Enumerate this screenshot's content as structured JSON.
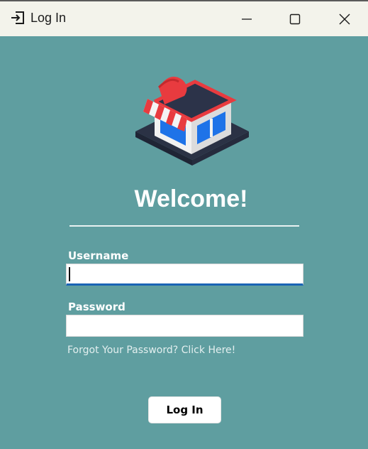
{
  "window": {
    "title": "Log In",
    "icons": {
      "app": "sign-in-icon",
      "minimize": "minimize-icon",
      "maximize": "maximize-icon",
      "close": "close-icon"
    }
  },
  "logo": {
    "icon": "storefront-icon",
    "colors": {
      "awning": "#e83b3f",
      "roof": "#2c3349",
      "window": "#1e73e8",
      "base": "#2b3245",
      "wall": "#f2f2f2"
    }
  },
  "heading": {
    "text": "Welcome!"
  },
  "form": {
    "username_label": "Username",
    "username_value": "",
    "password_label": "Password",
    "password_value": "",
    "forgot_link": "Forgot Your Password? Click Here!",
    "login_button": "Log In"
  },
  "colors": {
    "background": "#5f9ea0",
    "focus_underline": "#1a64b5",
    "titlebar": "#f3f3eb"
  }
}
